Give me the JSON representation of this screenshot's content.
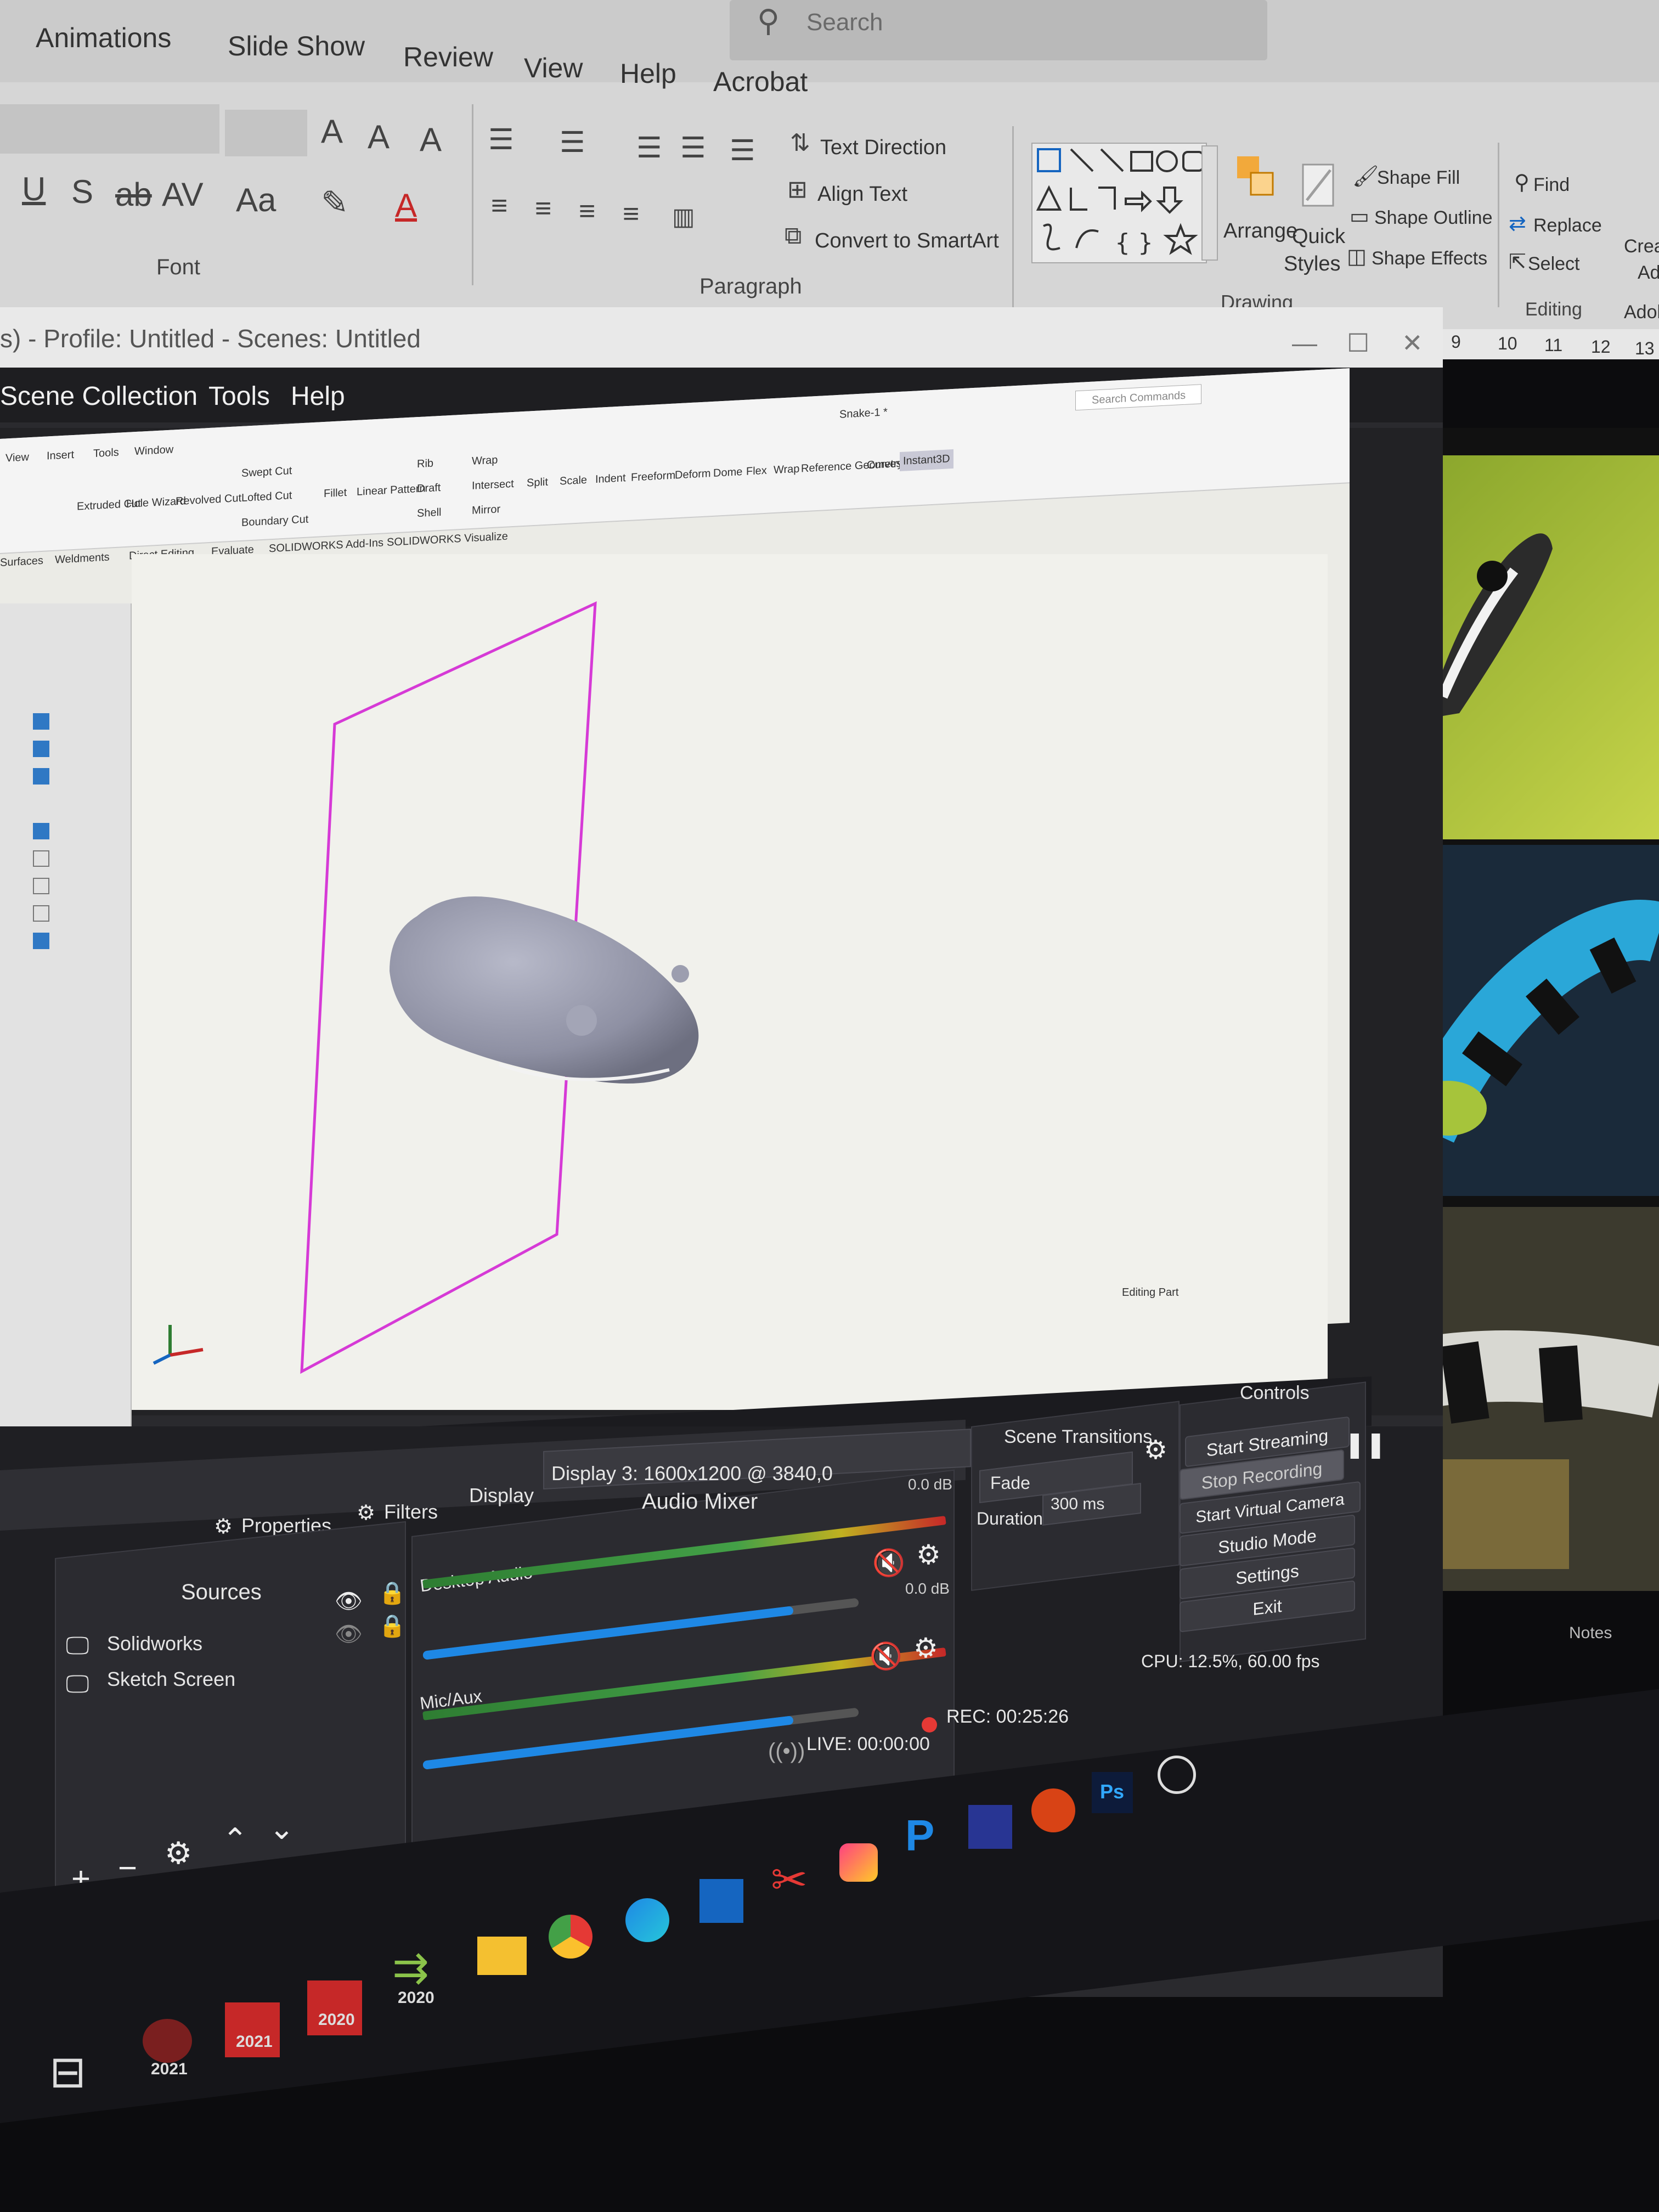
{
  "powerpoint": {
    "tabs": [
      "Animations",
      "Slide Show",
      "Review",
      "View",
      "Help",
      "Acrobat"
    ],
    "search_placeholder": "Search",
    "font_group": {
      "label": "Font",
      "buttons": [
        "U",
        "S",
        "ab",
        "AV",
        "Aa"
      ]
    },
    "paragraph_group": {
      "label": "Paragraph",
      "text_direction": "Text Direction",
      "align_text": "Align Text",
      "convert_smartart": "Convert to SmartArt"
    },
    "drawing_group": {
      "label": "Drawing",
      "arrange": "Arrange",
      "quick_styles_1": "Quick",
      "quick_styles_2": "Styles",
      "shape_fill": "Shape Fill",
      "shape_outline": "Shape Outline",
      "shape_effects": "Shape Effects"
    },
    "editing_group": {
      "label": "Editing",
      "find": "Find",
      "replace": "Replace",
      "select": "Select"
    },
    "adobe_1": "Creat",
    "adobe_2": "Ado",
    "adobe_3": "Adob",
    "ruler": [
      "9",
      "10",
      "11",
      "12",
      "13"
    ]
  },
  "obs": {
    "title": "s) - Profile: Untitled - Scenes: Untitled",
    "menu": [
      "Scene Collection",
      "Tools",
      "Help"
    ],
    "solidworks": {
      "menu": [
        "View",
        "Insert",
        "Tools",
        "Window"
      ],
      "features": [
        "Extruded Cut",
        "Hole Wizard",
        "Revolved Cut",
        "Swept Cut",
        "Lofted Cut",
        "Boundary Cut",
        "Fillet",
        "Linear Pattern",
        "Rib",
        "Draft",
        "Shell",
        "Wrap",
        "Intersect",
        "Mirror",
        "Split",
        "Scale",
        "Indent",
        "Freeform",
        "Deform",
        "Dome",
        "Flex",
        "Wrap",
        "Reference Geometry",
        "Curves",
        "Instant3D"
      ],
      "tabs": [
        "Surfaces",
        "Weldments",
        "Direct Editing",
        "Evaluate",
        "SOLIDWORKS Add-Ins",
        "SOLIDWORKS Visualize"
      ],
      "doc_name": "Snake-1 *",
      "search_commands": "Search Commands",
      "status": "Editing Part"
    },
    "source_bar": {
      "properties": "Properties",
      "filters": "Filters",
      "display": "Display",
      "display_value": "Display 3: 1600x1200 @ 3840,0"
    },
    "sources": {
      "title": "Sources",
      "items": [
        "Solidworks",
        "Sketch Screen"
      ]
    },
    "audio_mixer": {
      "title": "Audio Mixer",
      "channels": [
        {
          "name": "Desktop Audio",
          "level": "0.0 dB",
          "fader": 0.85
        },
        {
          "name": "Mic/Aux",
          "level": "0.0 dB",
          "fader": 0.85
        }
      ],
      "scale": [
        "-60",
        "-55",
        "-50",
        "-45",
        "-40",
        "-35",
        "-30",
        "-25",
        "-20",
        "-15",
        "-10",
        "-5",
        "0"
      ]
    },
    "scene_transitions": {
      "title": "Scene Transitions",
      "type": "Fade",
      "duration_label": "Duration",
      "duration_value": "300 ms"
    },
    "controls": {
      "title": "Controls",
      "buttons": [
        "Start Streaming",
        "Stop Recording",
        "Start Virtual Camera",
        "Studio Mode",
        "Settings",
        "Exit"
      ]
    },
    "status": {
      "live": "LIVE: 00:00:00",
      "rec": "REC: 00:25:26",
      "cpu": "CPU: 12.5%, 60.00 fps"
    }
  },
  "notes_label": "Notes",
  "taskbar": {
    "labels": [
      "2021",
      "2021",
      "2020",
      "2020"
    ],
    "ps_label": "Ps"
  },
  "colors": {
    "obs_bg": "#2a2a2e",
    "accent_blue": "#1e88e5",
    "rec_red": "#e53935",
    "plane_magenta": "#d63ad6",
    "model_gray": "#8e90a3"
  }
}
